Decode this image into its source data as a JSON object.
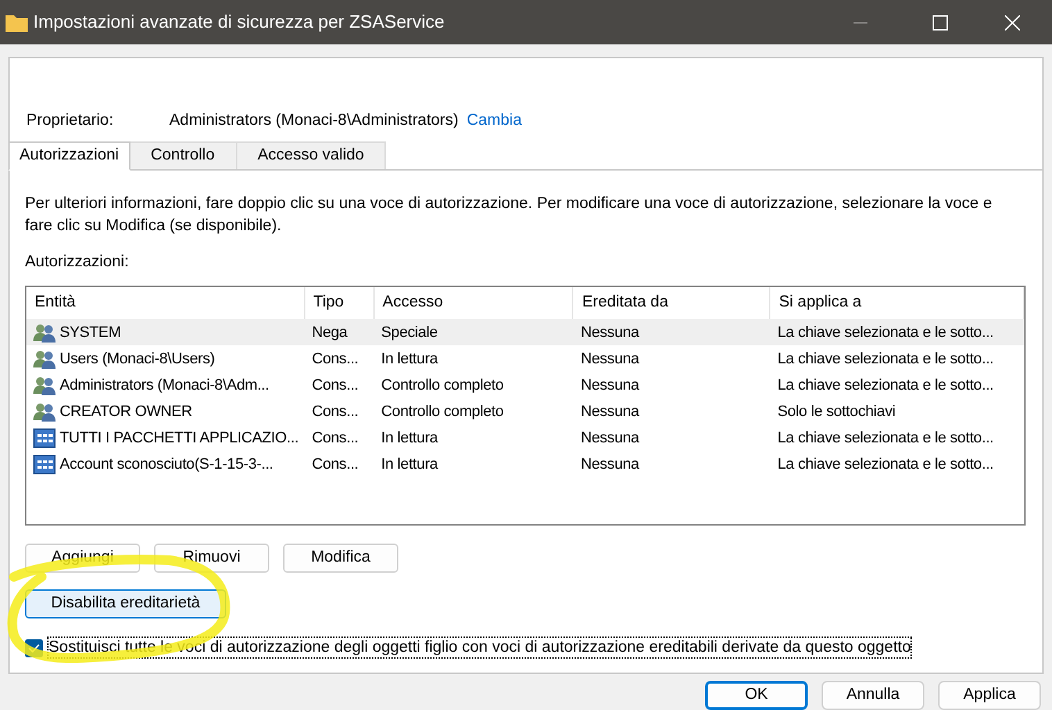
{
  "window": {
    "title": "Impostazioni avanzate di sicurezza per ZSAService"
  },
  "owner": {
    "label": "Proprietario:",
    "value": "Administrators (Monaci-8\\Administrators)",
    "link": "Cambia"
  },
  "tabs": [
    {
      "label": "Autorizzazioni",
      "selected": true
    },
    {
      "label": "Controllo",
      "selected": false
    },
    {
      "label": "Accesso valido",
      "selected": false
    }
  ],
  "description": "Per ulteriori informazioni, fare doppio clic su una voce di autorizzazione. Per modificare una voce di autorizzazione, selezionare la voce e fare clic su Modifica (se disponibile).",
  "table": {
    "label": "Autorizzazioni:",
    "columns": [
      "Entità",
      "Tipo",
      "Accesso",
      "Ereditata da",
      "Si applica a"
    ],
    "rows": [
      {
        "kind": "group",
        "selected": true,
        "cells": [
          "SYSTEM",
          "Nega",
          "Speciale",
          "Nessuna",
          "La chiave selezionata e le sotto..."
        ]
      },
      {
        "kind": "group",
        "selected": false,
        "cells": [
          "Users (Monaci-8\\Users)",
          "Cons...",
          "In lettura",
          "Nessuna",
          "La chiave selezionata e le sotto..."
        ]
      },
      {
        "kind": "group",
        "selected": false,
        "cells": [
          "Administrators (Monaci-8\\Adm...",
          "Cons...",
          "Controllo completo",
          "Nessuna",
          "La chiave selezionata e le sotto..."
        ]
      },
      {
        "kind": "group",
        "selected": false,
        "cells": [
          "CREATOR OWNER",
          "Cons...",
          "Controllo completo",
          "Nessuna",
          "Solo le sottochiavi"
        ]
      },
      {
        "kind": "app",
        "selected": false,
        "cells": [
          "TUTTI I PACCHETTI APPLICAZIO...",
          "Cons...",
          "In lettura",
          "Nessuna",
          "La chiave selezionata e le sotto..."
        ]
      },
      {
        "kind": "app",
        "selected": false,
        "cells": [
          "Account sconosciuto(S-1-15-3-...",
          "Cons...",
          "In lettura",
          "Nessuna",
          "La chiave selezionata e le sotto..."
        ]
      }
    ]
  },
  "actions": [
    "Aggiungi",
    "Rimuovi",
    "Modifica"
  ],
  "inheritance_button": "Disabilita ereditarietà",
  "replace_checkbox": {
    "label": "Sostituisci tutte le voci di autorizzazione degli oggetti figlio con voci di autorizzazione ereditabili derivate da questo oggetto",
    "checked": true
  },
  "footer_buttons": [
    {
      "label": "OK",
      "default": true
    },
    {
      "label": "Annulla",
      "default": false
    },
    {
      "label": "Applica",
      "default": false
    }
  ]
}
